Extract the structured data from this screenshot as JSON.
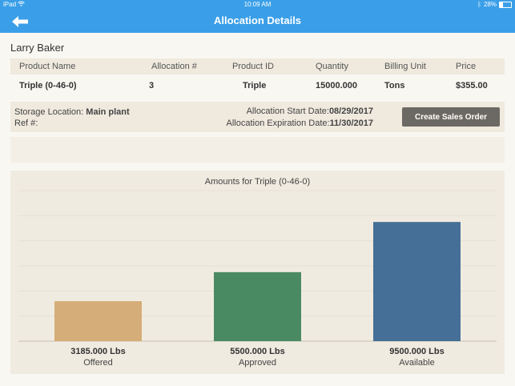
{
  "status_bar": {
    "device": "iPad",
    "time": "10:09 AM",
    "battery_text": "28%",
    "battery_level": 0.28
  },
  "nav": {
    "title": "Allocation Details",
    "back_icon": "arrow-left-icon"
  },
  "customer": {
    "name": "Larry Baker"
  },
  "table": {
    "headers": [
      "Product Name",
      "Allocation #",
      "Product ID",
      "Quantity",
      "Billing Unit",
      "Price"
    ],
    "row": [
      "Triple (0-46-0)",
      "3",
      "Triple",
      "15000.000",
      "Tons",
      "$355.00"
    ]
  },
  "storage": {
    "location_label": "Storage Location:",
    "location_value": "Main plant",
    "ref_label": "Ref #:",
    "start_label": "Allocation Start Date:",
    "start_value": "08/29/2017",
    "expiration_label": "Allocation Expiration Date:",
    "expiration_value": "11/30/2017",
    "sales_order_button": "Create Sales Order"
  },
  "colors": {
    "header_blue": "#3a9fe8",
    "offered": "#d5ad78",
    "approved": "#4a8a63",
    "available": "#456f97",
    "button": "#6c6863"
  },
  "chart_data": {
    "type": "bar",
    "title": "Amounts for Triple (0-46-0)",
    "categories": [
      "Offered",
      "Approved",
      "Available"
    ],
    "values": [
      3185,
      5500,
      9500
    ],
    "value_labels": [
      "3185.000 Lbs",
      "5500.000 Lbs",
      "9500.000 Lbs"
    ],
    "colors": [
      "#d5ad78",
      "#4a8a63",
      "#456f97"
    ],
    "ylim": [
      0,
      12000
    ],
    "grid": true
  }
}
